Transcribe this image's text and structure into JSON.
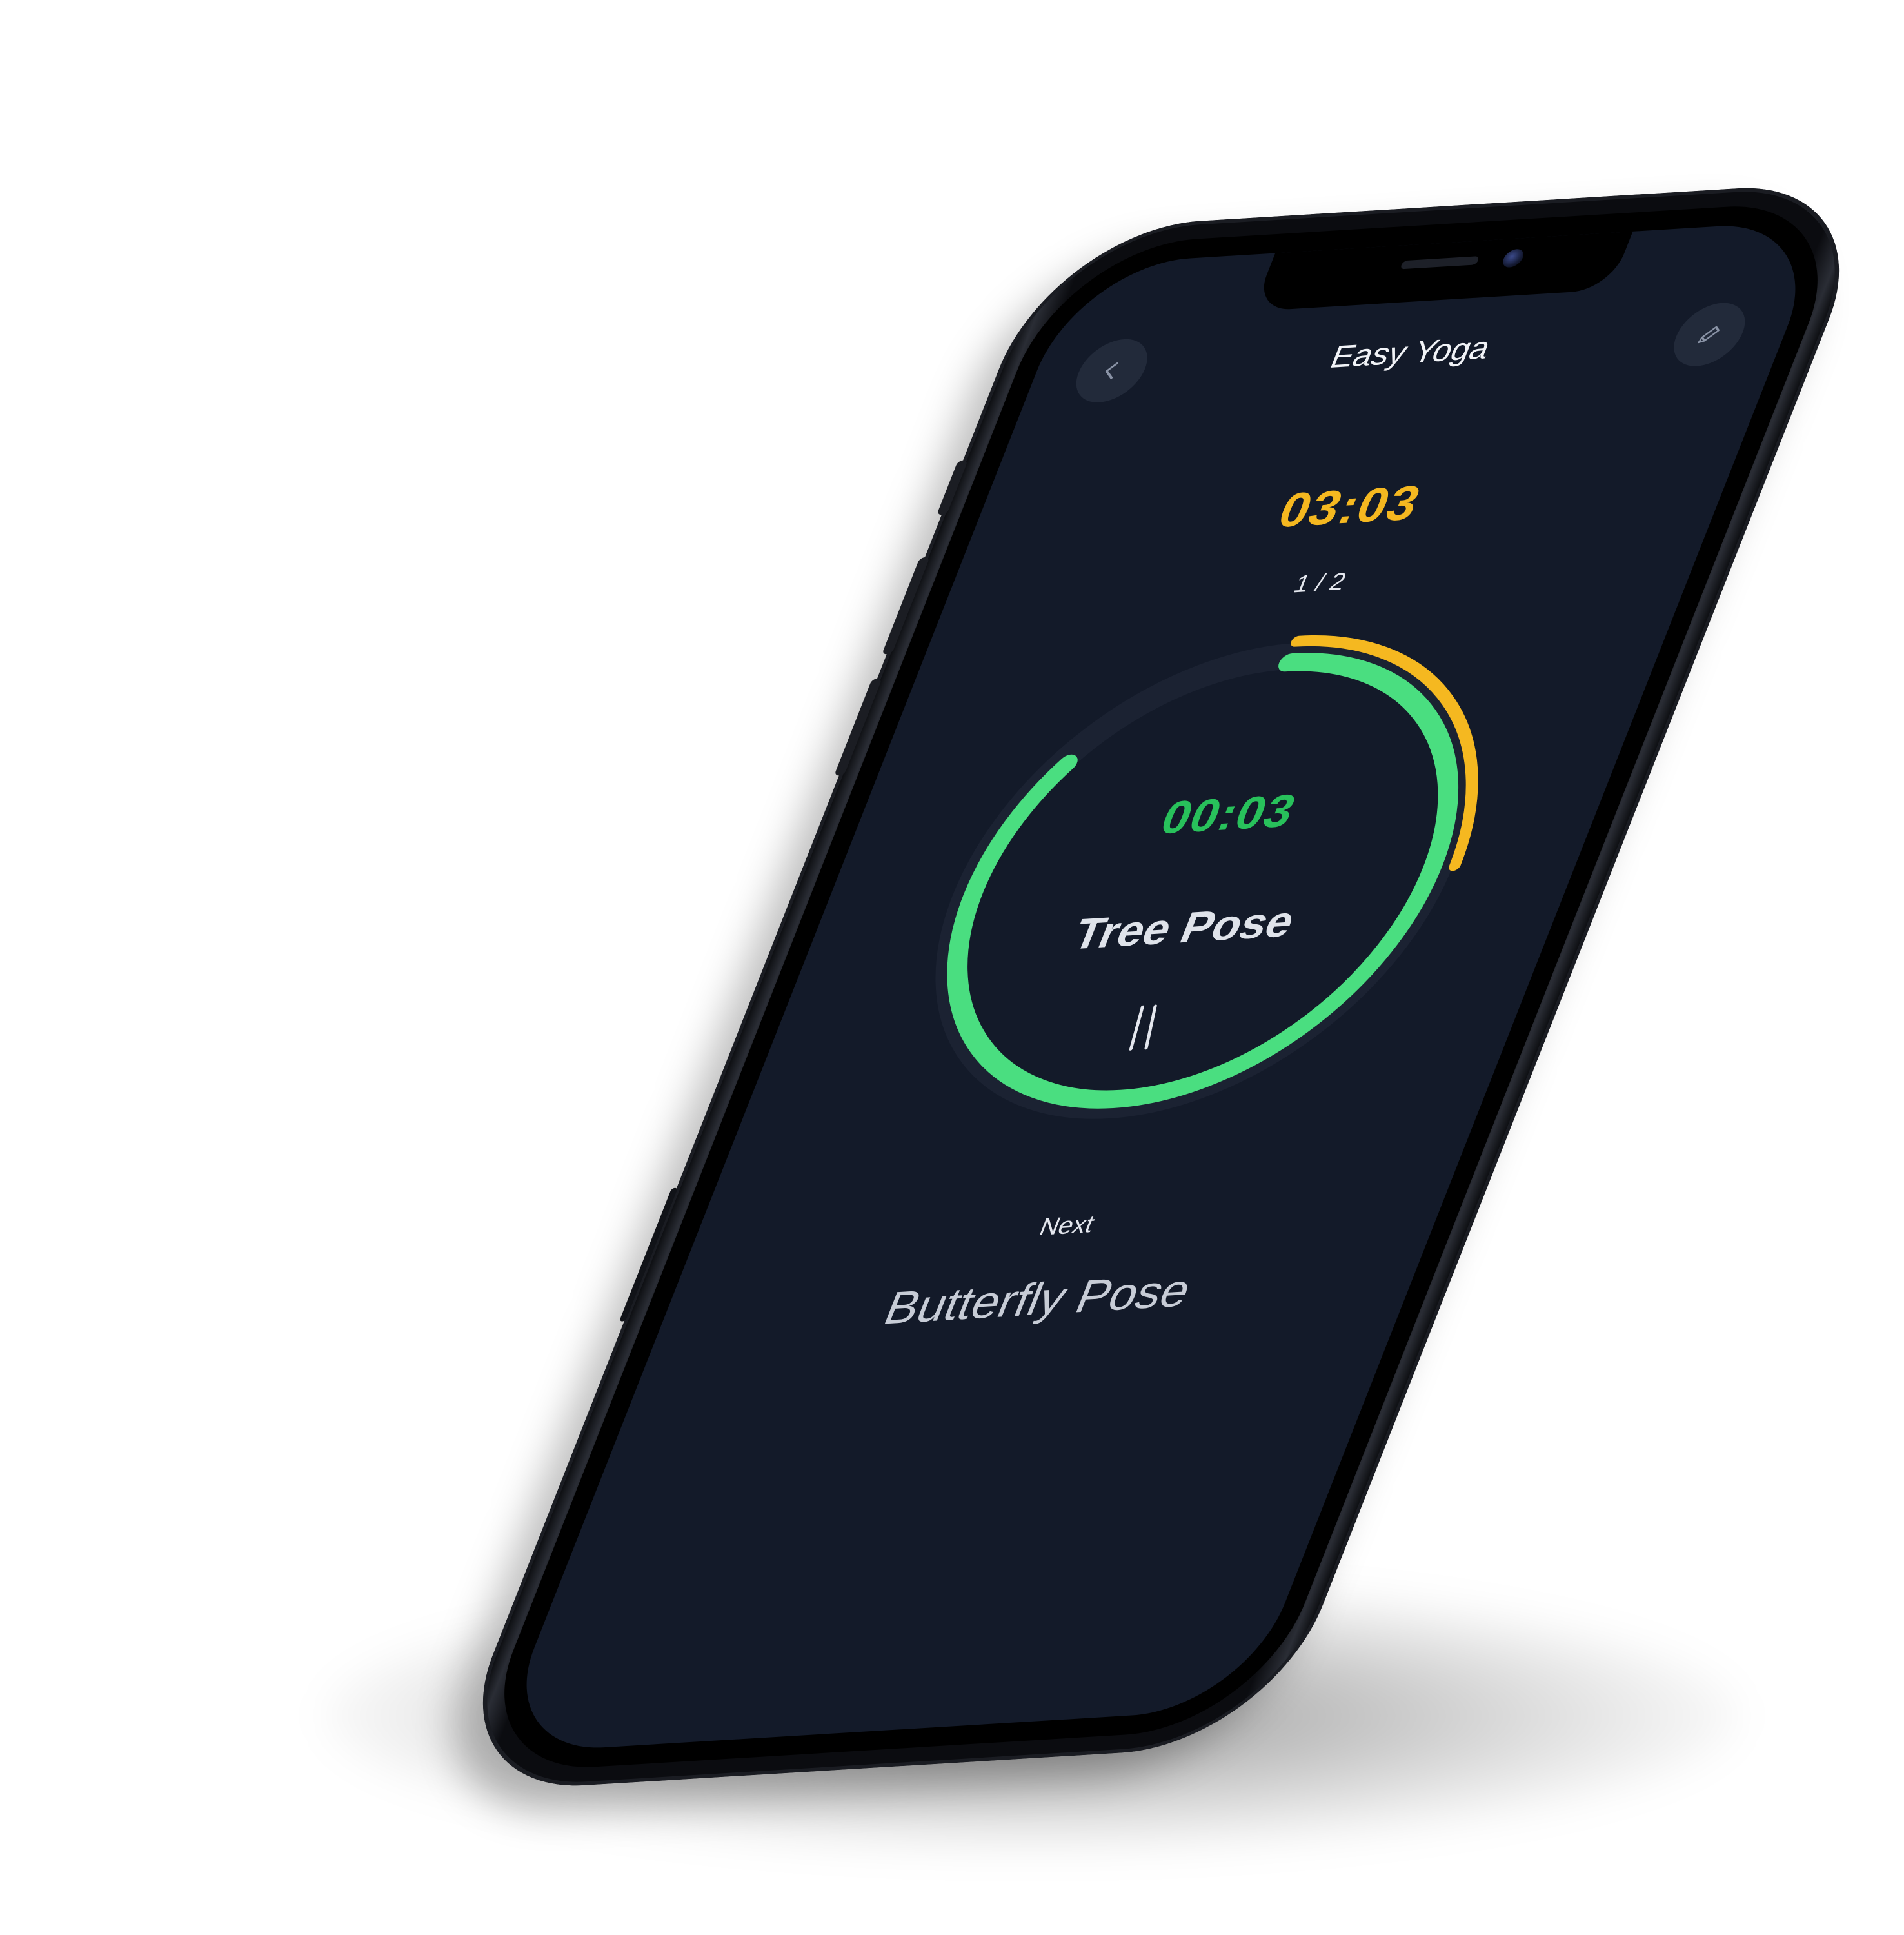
{
  "header": {
    "title": "Easy Yoga",
    "back_icon": "chevron-left-icon",
    "edit_icon": "pencil-icon"
  },
  "timer": {
    "total_time": "03:03",
    "progress": "1 / 2",
    "step_time": "00:03",
    "current_pose": "Tree Pose",
    "pause_icon": "pause-icon"
  },
  "rings": {
    "overall_progress": 0.25,
    "step_progress": 0.85,
    "colors": {
      "overall": "#f5b820",
      "step": "#4ade80",
      "track": "#1b2232"
    }
  },
  "next": {
    "label": "Next",
    "pose": "Butterfly Pose"
  },
  "colors": {
    "screen_bg": "#131a29",
    "accent_yellow": "#f5b820",
    "accent_green": "#28c15b"
  }
}
